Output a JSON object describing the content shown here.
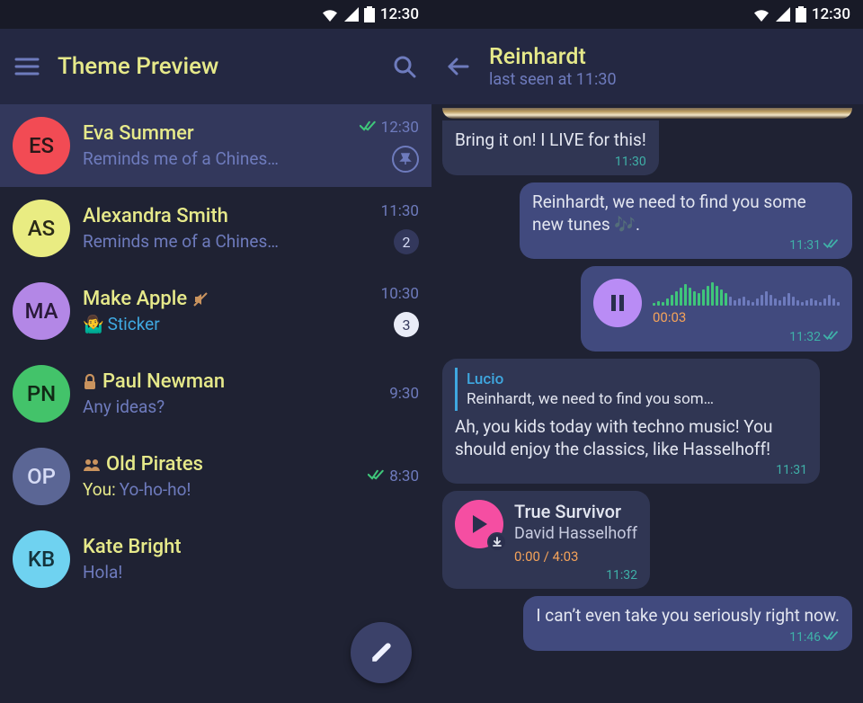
{
  "status": {
    "time": "12:30"
  },
  "left": {
    "title": "Theme Preview",
    "chats": [
      {
        "initials": "ES",
        "avatar_bg": "#f24b54",
        "name": "Eva Summer",
        "preview": "Reminds me of a Chines…",
        "time": "12:30",
        "checks": true,
        "pinned": true
      },
      {
        "initials": "AS",
        "avatar_bg": "#e9ec82",
        "name": "Alexandra Smith",
        "preview": "Reminds me of a Chines…",
        "time": "11:30",
        "badge": "2"
      },
      {
        "initials": "MA",
        "avatar_bg": "#b387e6",
        "name": "Make Apple",
        "muted": true,
        "sticker_emoji": "🤷‍♂️",
        "sticker_label": "Sticker",
        "time": "10:30",
        "badge": "3",
        "badge_light": true
      },
      {
        "initials": "PN",
        "avatar_bg": "#43c36a",
        "name": "Paul Newman",
        "locked": true,
        "preview": "Any ideas?",
        "time": "9:30"
      },
      {
        "initials": "OP",
        "avatar_bg": "#4a5590",
        "avatar_fg": "#c8cee8",
        "name": "Old Pirates",
        "group": true,
        "you_prefix": "You:",
        "preview": "Yo-ho-ho!",
        "time": "8:30",
        "checks": true
      },
      {
        "initials": "KB",
        "avatar_bg": "#6fd2f0",
        "name": "Kate Bright",
        "preview": "Hola!"
      }
    ]
  },
  "right": {
    "header": {
      "name": "Reinhardt",
      "sub": "last seen at 11:30"
    },
    "messages": [
      {
        "dir": "in",
        "kind": "text",
        "text": "Bring it on! I LIVE for this!",
        "time": "11:30"
      },
      {
        "dir": "out",
        "kind": "text",
        "text": "Reinhardt, we need to find you some new tunes 🎶.",
        "time": "11:31",
        "checks": true
      },
      {
        "dir": "out",
        "kind": "voice",
        "duration": "00:03",
        "time": "11:32",
        "checks": true
      },
      {
        "dir": "in",
        "kind": "reply",
        "reply_name": "Lucio",
        "reply_text": "Reinhardt, we need to find you som…",
        "text": "Ah, you kids today with techno music! You should enjoy the classics, like Hasselhoff!",
        "time": "11:31"
      },
      {
        "dir": "in",
        "kind": "audio",
        "title": "True Survivor",
        "artist": "David Hasselhoff",
        "duration": "0:00 / 4:03",
        "time": "11:32"
      },
      {
        "dir": "out",
        "kind": "text",
        "text": "I can’t even take you seriously right now.",
        "time": "11:46",
        "checks": true
      }
    ]
  }
}
